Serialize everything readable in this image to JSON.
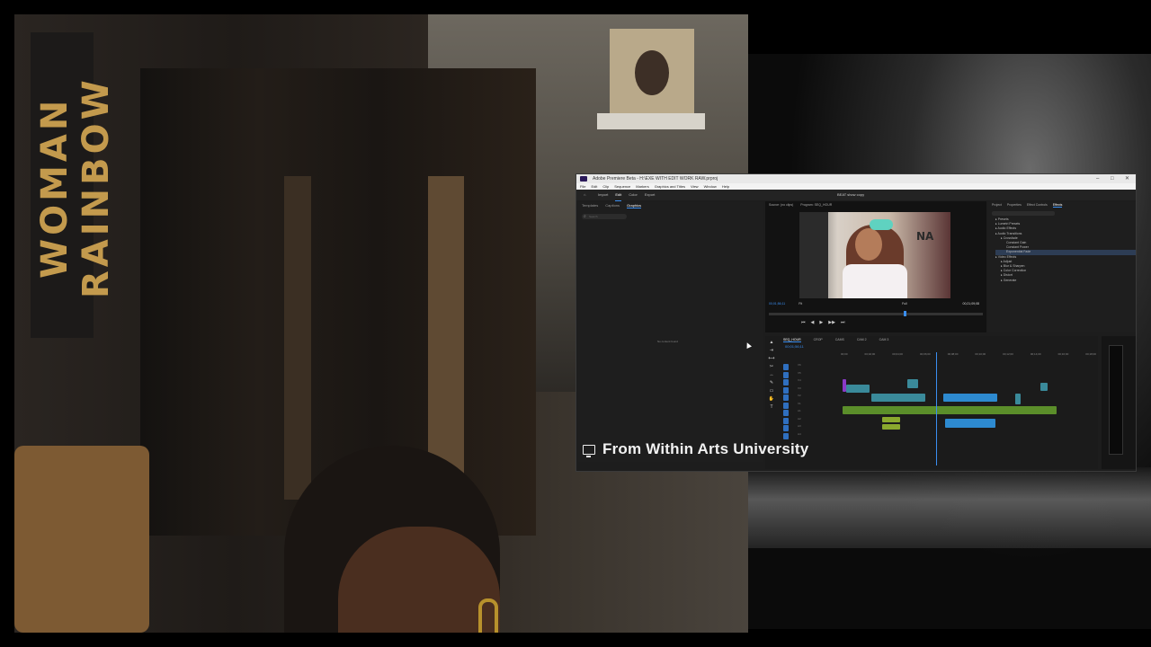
{
  "background": {
    "banner_text": "WOMAN RAINBOW"
  },
  "window": {
    "title": "Adobe Premiere Beta - H:\\EXE WITH EDIT WORK RAW.prproj",
    "controls": [
      "–",
      "□",
      "✕"
    ],
    "menu": [
      "File",
      "Edit",
      "Clip",
      "Sequence",
      "Markers",
      "Graphics and Titles",
      "View",
      "Window",
      "Help"
    ],
    "workspaces": [
      "Import",
      "Edit",
      "Color",
      "Export"
    ],
    "active_workspace": "Edit",
    "project_name": "BEAT show copy"
  },
  "left_panel": {
    "tabs": [
      "Templates",
      "Captions",
      "Graphics"
    ],
    "active_tab": "Graphics",
    "search_placeholder": "Search",
    "empty_text": "No content found"
  },
  "program_monitor": {
    "tabs": [
      "Source: (no clips)",
      "Program: SEQ_HOUR"
    ],
    "video_sign_text": "NA",
    "timecode": "00;01;56;11",
    "fit": "Fit",
    "quality": "Full",
    "duration": "00;21;09;08",
    "transport": [
      "⏮",
      "◀",
      "▶",
      "▶▶",
      "⏭"
    ]
  },
  "effects_panel": {
    "tabs": [
      "Project",
      "Properties",
      "Effect Controls",
      "Effects"
    ],
    "active_tab": "Effects",
    "tree": [
      {
        "label": "Presets",
        "level": 1
      },
      {
        "label": "Lumetri Presets",
        "level": 1
      },
      {
        "label": "Audio Effects",
        "level": 1
      },
      {
        "label": "Audio Transitions",
        "level": 1
      },
      {
        "label": "Crossfade",
        "level": 2
      },
      {
        "label": "Constant Gain",
        "level": 3
      },
      {
        "label": "Constant Power",
        "level": 3
      },
      {
        "label": "Exponential Fade",
        "level": 3,
        "selected": true
      },
      {
        "label": "Video Effects",
        "level": 1
      },
      {
        "label": "Adjust",
        "level": 2
      },
      {
        "label": "Blur & Sharpen",
        "level": 2
      },
      {
        "label": "Color Correction",
        "level": 2
      },
      {
        "label": "Distort",
        "level": 2
      },
      {
        "label": "Generate",
        "level": 2
      }
    ]
  },
  "timeline": {
    "tabs": [
      "SEQ_HOUR",
      "CROP",
      "CAMS",
      "CAM 2",
      "CAM 3"
    ],
    "active_tab": "SEQ_HOUR",
    "timecode": "00;01;56;11",
    "ruler": [
      "00;00",
      "00;02;00",
      "00;04;00",
      "00;06;00",
      "00;08;00",
      "00;10;00",
      "00;12;00",
      "00;14;00",
      "00;16;00",
      "00;18;00"
    ],
    "tracks": [
      "V6",
      "V5",
      "V4",
      "V3",
      "V2",
      "V1",
      "A1",
      "A2",
      "A3",
      "A4"
    ]
  },
  "notification": {
    "text": "From Within Arts University"
  }
}
